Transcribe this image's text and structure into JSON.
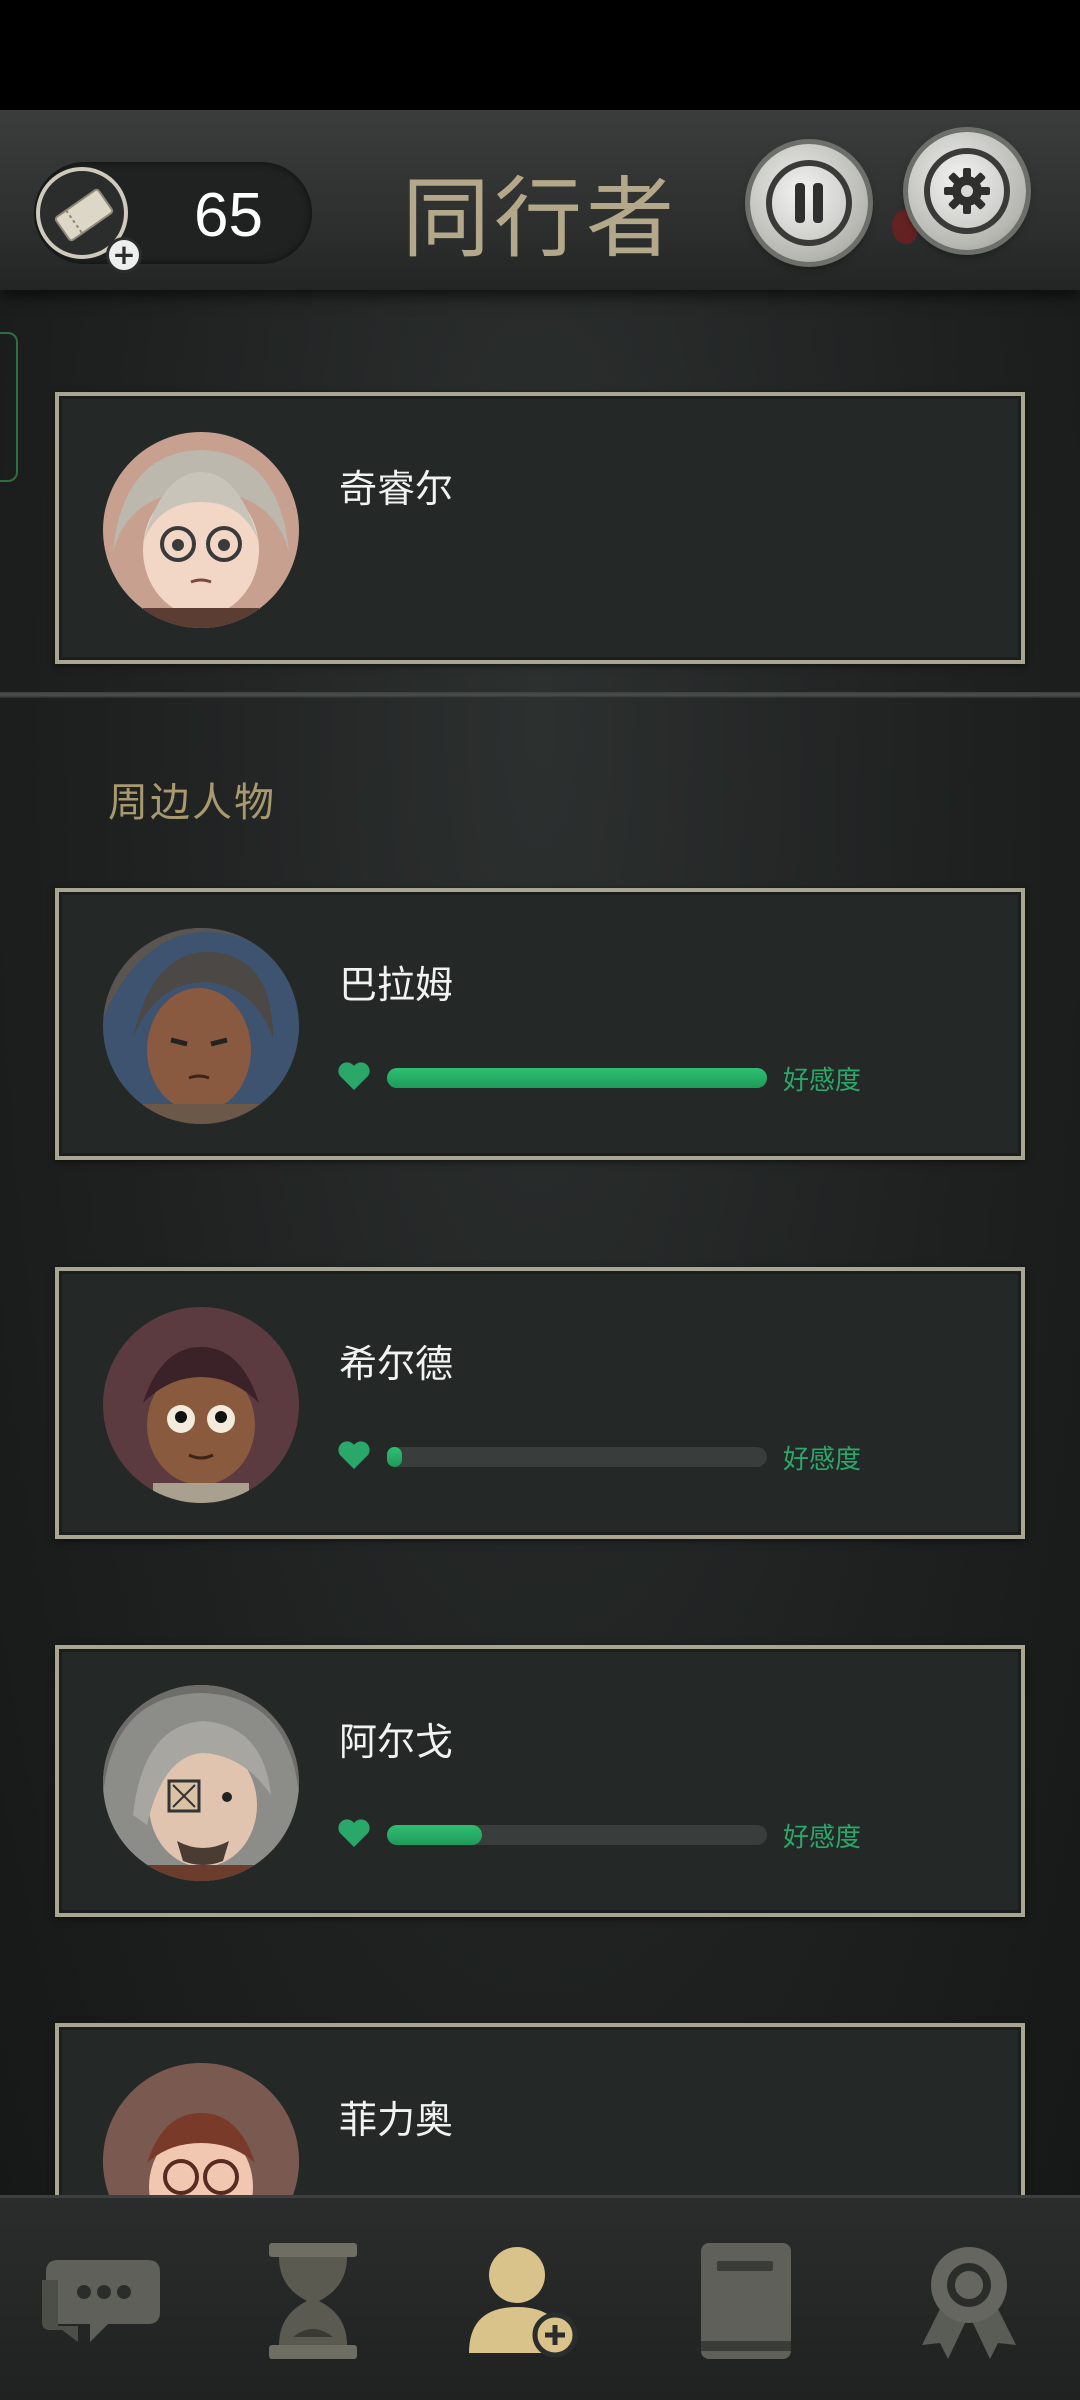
{
  "header": {
    "title": "同行者",
    "ticket_count": "65"
  },
  "companions": [
    {
      "name": "奇睿尔"
    }
  ],
  "section": {
    "title": "周边人物"
  },
  "nearby": [
    {
      "name": "巴拉姆",
      "affinity_label": "好感度",
      "affinity_fraction": 1.0
    },
    {
      "name": "希尔德",
      "affinity_label": "好感度",
      "affinity_fraction": 0.04
    },
    {
      "name": "阿尔戈",
      "affinity_label": "好感度",
      "affinity_fraction": 0.25
    },
    {
      "name": "菲力奥"
    }
  ],
  "nav": {
    "items": [
      "chat-icon",
      "hourglass-icon",
      "companions-icon",
      "journal-icon",
      "achievements-icon"
    ],
    "active": "companions-icon"
  },
  "colors": {
    "accent_green": "#2aa86a",
    "title_gold": "#b3a88a",
    "card_border": "#a9a593",
    "nav_active": "#d9c38a"
  }
}
